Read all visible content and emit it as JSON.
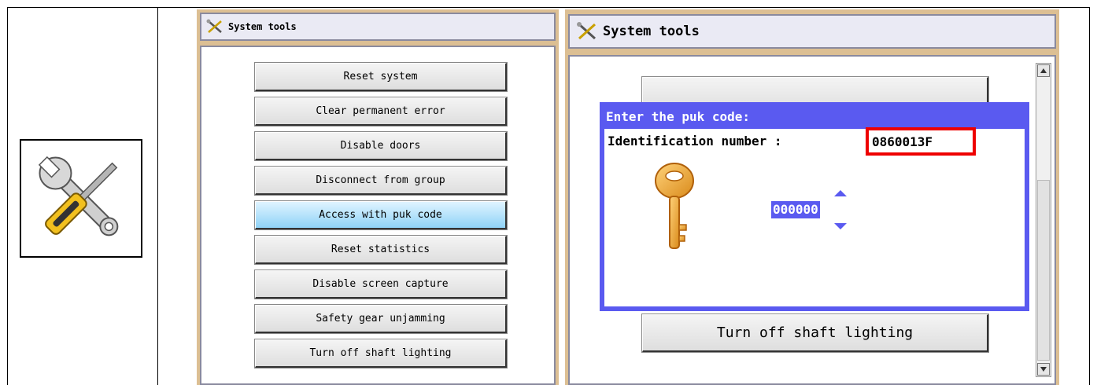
{
  "app_icon": "tools-icon",
  "left_panel": {
    "title": "System tools",
    "menu": [
      {
        "label": "Reset system",
        "active": false
      },
      {
        "label": "Clear permanent error",
        "active": false
      },
      {
        "label": "Disable doors",
        "active": false
      },
      {
        "label": "Disconnect from group",
        "active": false
      },
      {
        "label": "Access with puk code",
        "active": true
      },
      {
        "label": "Reset statistics",
        "active": false
      },
      {
        "label": "Disable screen capture",
        "active": false
      },
      {
        "label": "Safety gear unjamming",
        "active": false
      },
      {
        "label": "Turn off shaft lighting",
        "active": false
      }
    ]
  },
  "right_panel": {
    "title": "System tools",
    "visible_button": "Turn off shaft lighting",
    "dialog": {
      "title": "Enter the puk code:",
      "id_label": "Identification number :",
      "id_value": "0860013F",
      "puk_value": "000000"
    }
  },
  "colors": {
    "panel_frame": "#dcbf93",
    "dialog_blue": "#5a5af0",
    "highlight_red": "#ee0000",
    "active_button": "#8fd3f7"
  }
}
